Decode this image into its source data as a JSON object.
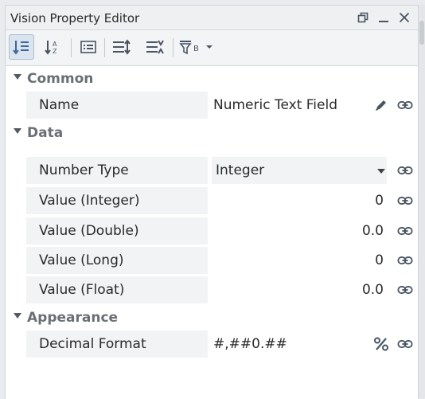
{
  "window": {
    "title": "Vision Property Editor",
    "controls": [
      "restore-icon",
      "minimize-icon",
      "close-icon"
    ]
  },
  "toolbar": {
    "buttons": [
      {
        "name": "sort-by-category-button",
        "icon": "sort-category-icon",
        "active": true
      },
      {
        "name": "sort-alphabetical-button",
        "icon": "sort-az-icon",
        "active": false
      },
      {
        "name": "show-description-button",
        "icon": "description-icon",
        "active": false
      },
      {
        "name": "expand-all-button",
        "icon": "expand-all-icon",
        "active": false
      },
      {
        "name": "collapse-all-button",
        "icon": "collapse-all-icon",
        "active": false
      },
      {
        "name": "filter-button",
        "icon": "filter-icon",
        "active": false
      },
      {
        "name": "filter-dropdown-button",
        "icon": "chevron-down-icon",
        "active": false
      }
    ],
    "filter_subscript": "B"
  },
  "categories": {
    "common": {
      "label": "Common",
      "props": {
        "name": {
          "label": "Name",
          "value": "Numeric Text Field"
        }
      }
    },
    "data": {
      "label": "Data",
      "props": {
        "number_type": {
          "label": "Number Type",
          "value": "Integer"
        },
        "value_integer": {
          "label": "Value (Integer)",
          "value": "0"
        },
        "value_double": {
          "label": "Value (Double)",
          "value": "0.0"
        },
        "value_long": {
          "label": "Value (Long)",
          "value": "0"
        },
        "value_float": {
          "label": "Value (Float)",
          "value": "0.0"
        }
      }
    },
    "appearance": {
      "label": "Appearance",
      "props": {
        "decimal_format": {
          "label": "Decimal Format",
          "value": "#,##0.##"
        }
      }
    }
  },
  "colors": {
    "accent": "#3b6a9a",
    "icon": "#4a5563",
    "category_text": "#6b6f75"
  }
}
